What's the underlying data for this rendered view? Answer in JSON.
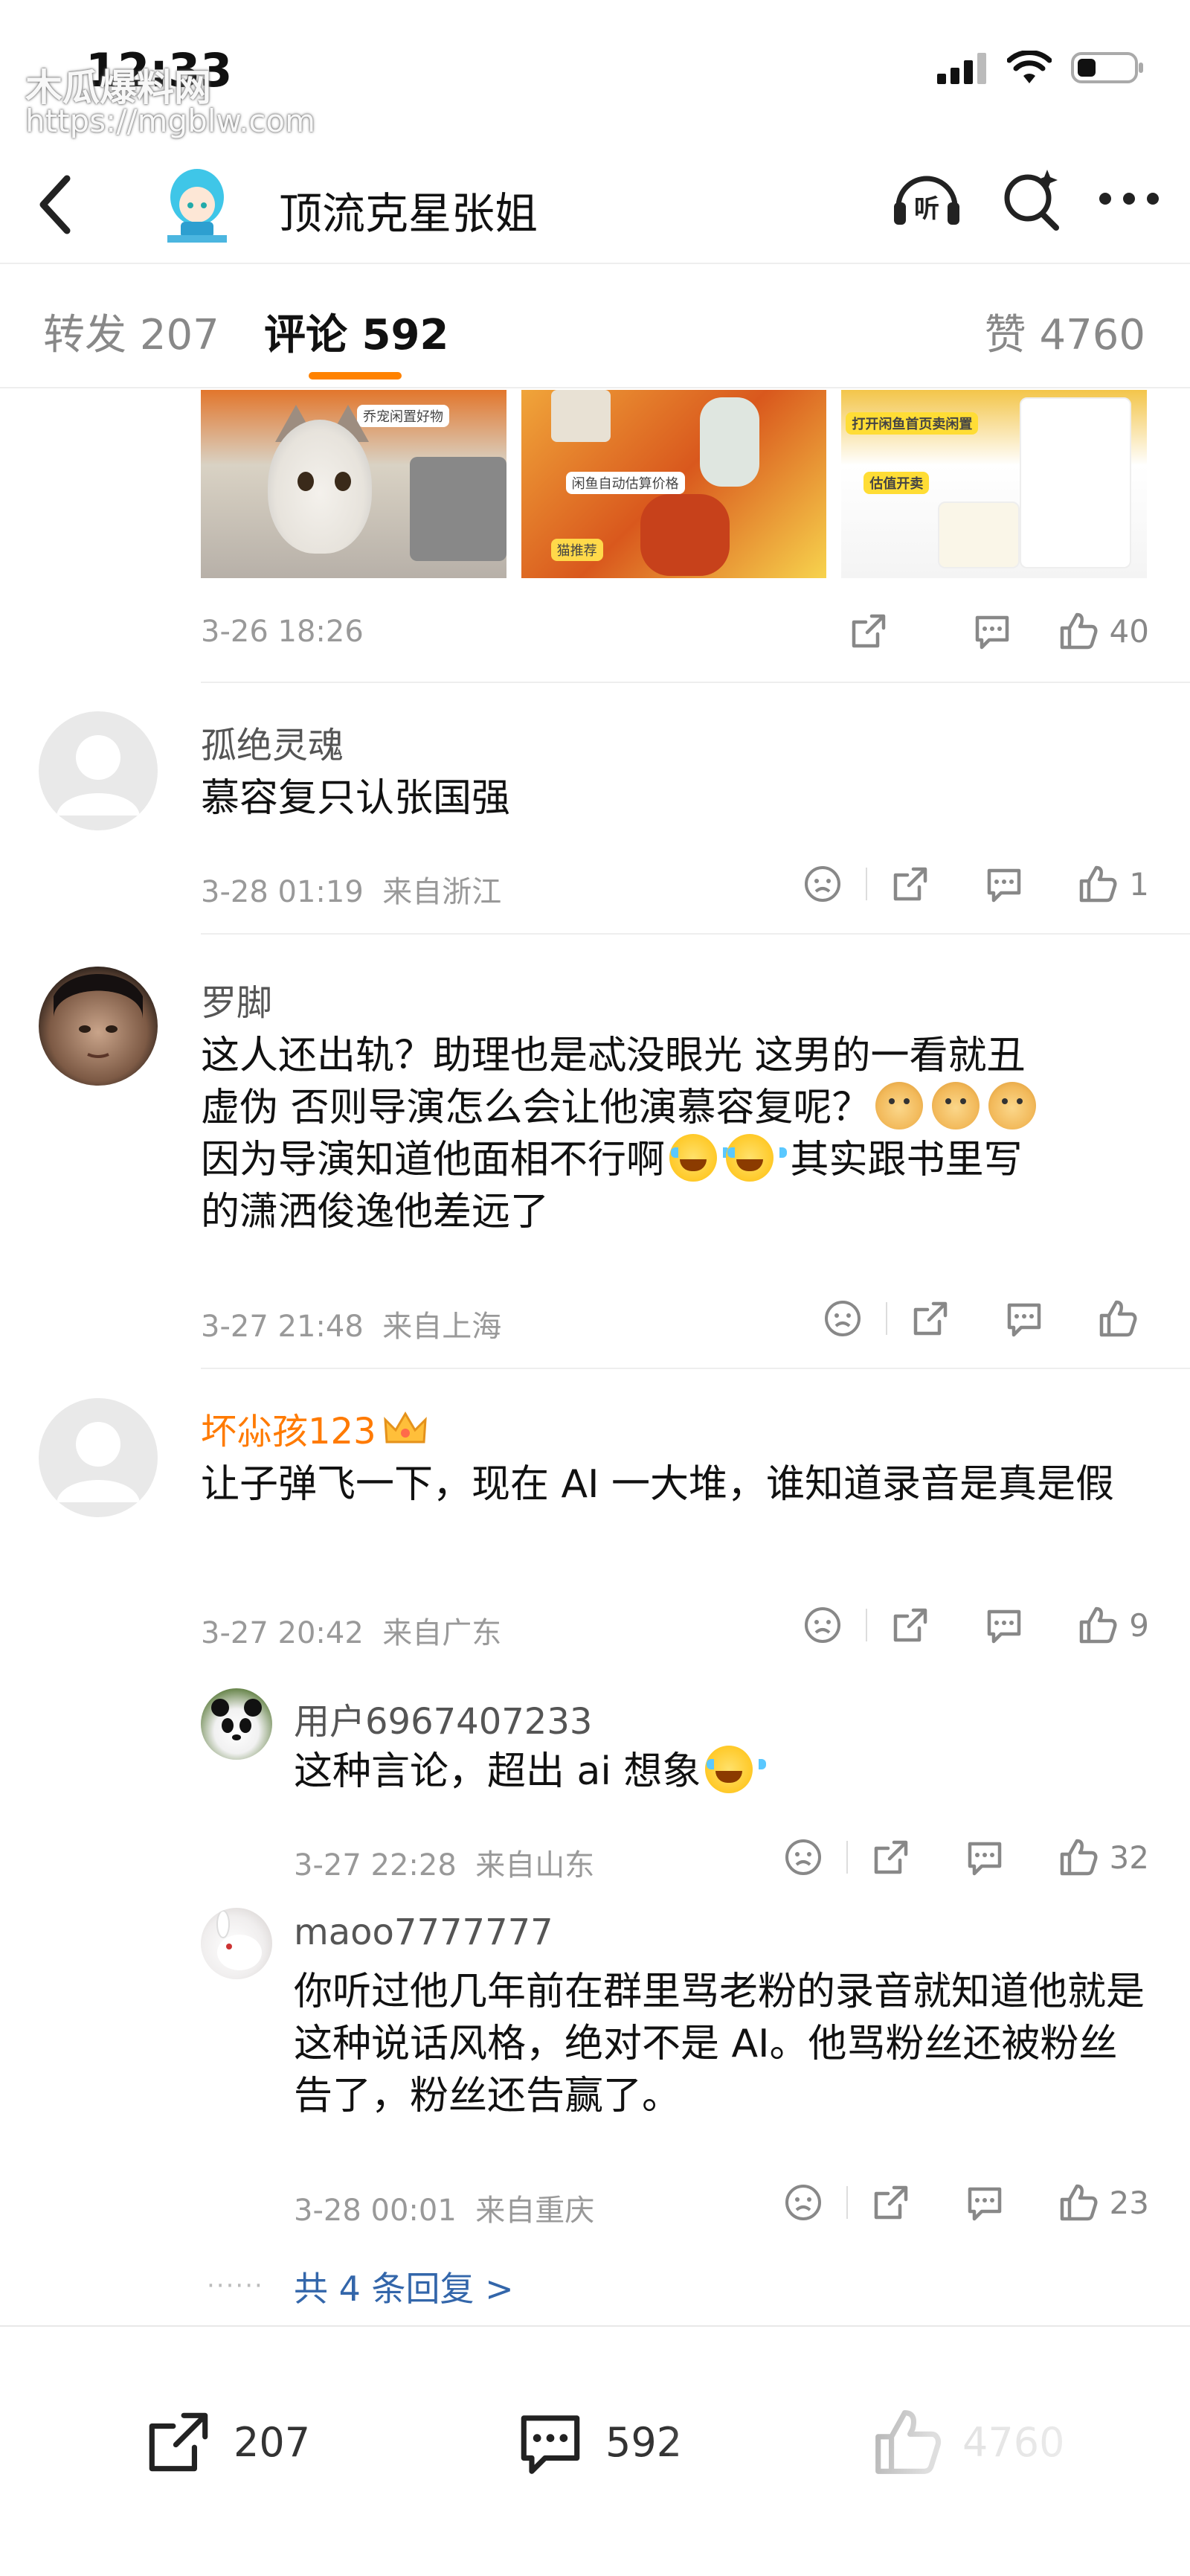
{
  "status_bar": {
    "time": "12:33",
    "watermark_line1": "木瓜爆料网",
    "watermark_line2": "https://mgblw.com",
    "icons": [
      "signal-icon",
      "wifi-icon",
      "battery-icon"
    ]
  },
  "header": {
    "title": "顶流克星张姐",
    "listen_label": "听",
    "icons": [
      "back-icon",
      "listen-icon",
      "search-icon",
      "more-icon"
    ]
  },
  "tabs": {
    "forward_label": "转发",
    "forward_count": "207",
    "comment_label": "评论",
    "comment_count": "592",
    "like_label": "赞",
    "like_count": "4760",
    "active": "comment"
  },
  "top_post": {
    "image_captions": [
      "乔宠闲置好物",
      "闲鱼自动估算价格",
      "打开闲鱼首页卖闲置",
      "估值开卖",
      "猫推荐"
    ],
    "time": "3-26 18:26",
    "like_count": "40"
  },
  "comments": [
    {
      "username": "孤绝灵魂",
      "text": "慕容复只认张国强",
      "time": "3-28 01:19",
      "location": "来自浙江",
      "like_count": "1"
    },
    {
      "username": "罗脚",
      "text_part1": "这人还出轨？助理也是忒没眼光  这男的一看就丑",
      "text_part2": "虚伪  否则导演怎么会让他演慕容复呢？",
      "text_part3": "因为导演知道他面相不行啊",
      "text_part4": "  其实跟书里写",
      "text_part5": "的潇洒俊逸他差远了",
      "time": "3-27 21:48",
      "location": "来自上海",
      "like_count": ""
    },
    {
      "username": "坏尛孩123",
      "text": "让子弹飞一下，现在 AI 一大堆，谁知道录音是真是假",
      "time": "3-27 20:42",
      "location": "来自广东",
      "like_count": "9",
      "replies": [
        {
          "username": "用户6967407233",
          "text": "这种言论，超出 ai 想象",
          "time": "3-27 22:28",
          "location": "来自山东",
          "like_count": "32"
        },
        {
          "username": "maoo7777777",
          "text": "你听过他几年前在群里骂老粉的录音就知道他就是这种说话风格，绝对不是 AI。他骂粉丝还被粉丝告了，粉丝还告赢了。",
          "time": "3-28 00:01",
          "location": "来自重庆",
          "like_count": "23"
        }
      ],
      "more_replies_label": "共 4 条回复 >"
    }
  ],
  "bottom_bar": {
    "forward_count": "207",
    "comment_count": "592",
    "like_count": "4760"
  },
  "colors": {
    "accent": "#ff8200",
    "vip_name": "#ff7a00",
    "link": "#3366aa",
    "muted": "#999999"
  }
}
